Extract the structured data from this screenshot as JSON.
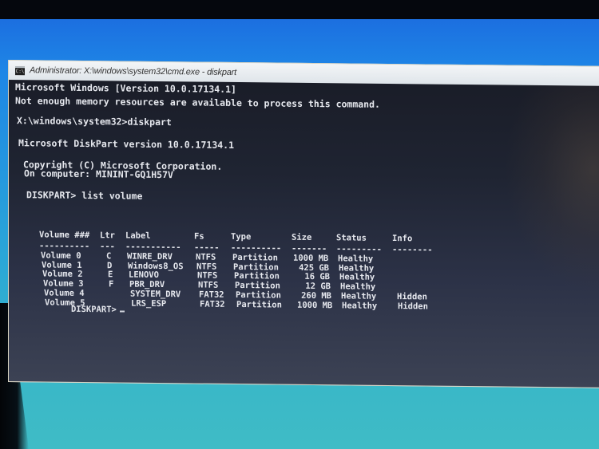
{
  "window": {
    "title": "Administrator: X:\\windows\\system32\\cmd.exe - diskpart",
    "icon": "cmd-app-icon",
    "icon_text": "C:\\"
  },
  "console": {
    "lines": [
      "Microsoft Windows [Version 10.0.17134.1]",
      "Not enough memory resources are available to process this command.",
      "X:\\windows\\system32>diskpart",
      "Microsoft DiskPart version 10.0.17134.1",
      "Copyright (C) Microsoft Corporation.",
      "On computer: MININT-GQ1H57V",
      "DISKPART> list volume"
    ],
    "table": {
      "headers": [
        "Volume ###",
        "Ltr",
        "Label",
        "Fs",
        "Type",
        "Size",
        "Status",
        "Info"
      ],
      "separators": [
        "----------",
        "---",
        "-----------",
        "-----",
        "----------",
        "-------",
        "---------",
        "--------"
      ],
      "rows": [
        {
          "volume": "Volume 0",
          "ltr": "C",
          "label": "WINRE_DRV",
          "fs": "NTFS",
          "type": "Partition",
          "size": "1000 MB",
          "status": "Healthy",
          "info": ""
        },
        {
          "volume": "Volume 1",
          "ltr": "D",
          "label": "Windows8_OS",
          "fs": "NTFS",
          "type": "Partition",
          "size": "425 GB",
          "status": "Healthy",
          "info": ""
        },
        {
          "volume": "Volume 2",
          "ltr": "E",
          "label": "LENOVO",
          "fs": "NTFS",
          "type": "Partition",
          "size": "16 GB",
          "status": "Healthy",
          "info": ""
        },
        {
          "volume": "Volume 3",
          "ltr": "F",
          "label": "PBR_DRV",
          "fs": "NTFS",
          "type": "Partition",
          "size": "12 GB",
          "status": "Healthy",
          "info": ""
        },
        {
          "volume": "Volume 4",
          "ltr": "",
          "label": "SYSTEM_DRV",
          "fs": "FAT32",
          "type": "Partition",
          "size": "260 MB",
          "status": "Healthy",
          "info": "Hidden"
        },
        {
          "volume": "Volume 5",
          "ltr": "",
          "label": "LRS_ESP",
          "fs": "FAT32",
          "type": "Partition",
          "size": "1000 MB",
          "status": "Healthy",
          "info": "Hidden"
        }
      ]
    },
    "prompt": "DISKPART>"
  }
}
